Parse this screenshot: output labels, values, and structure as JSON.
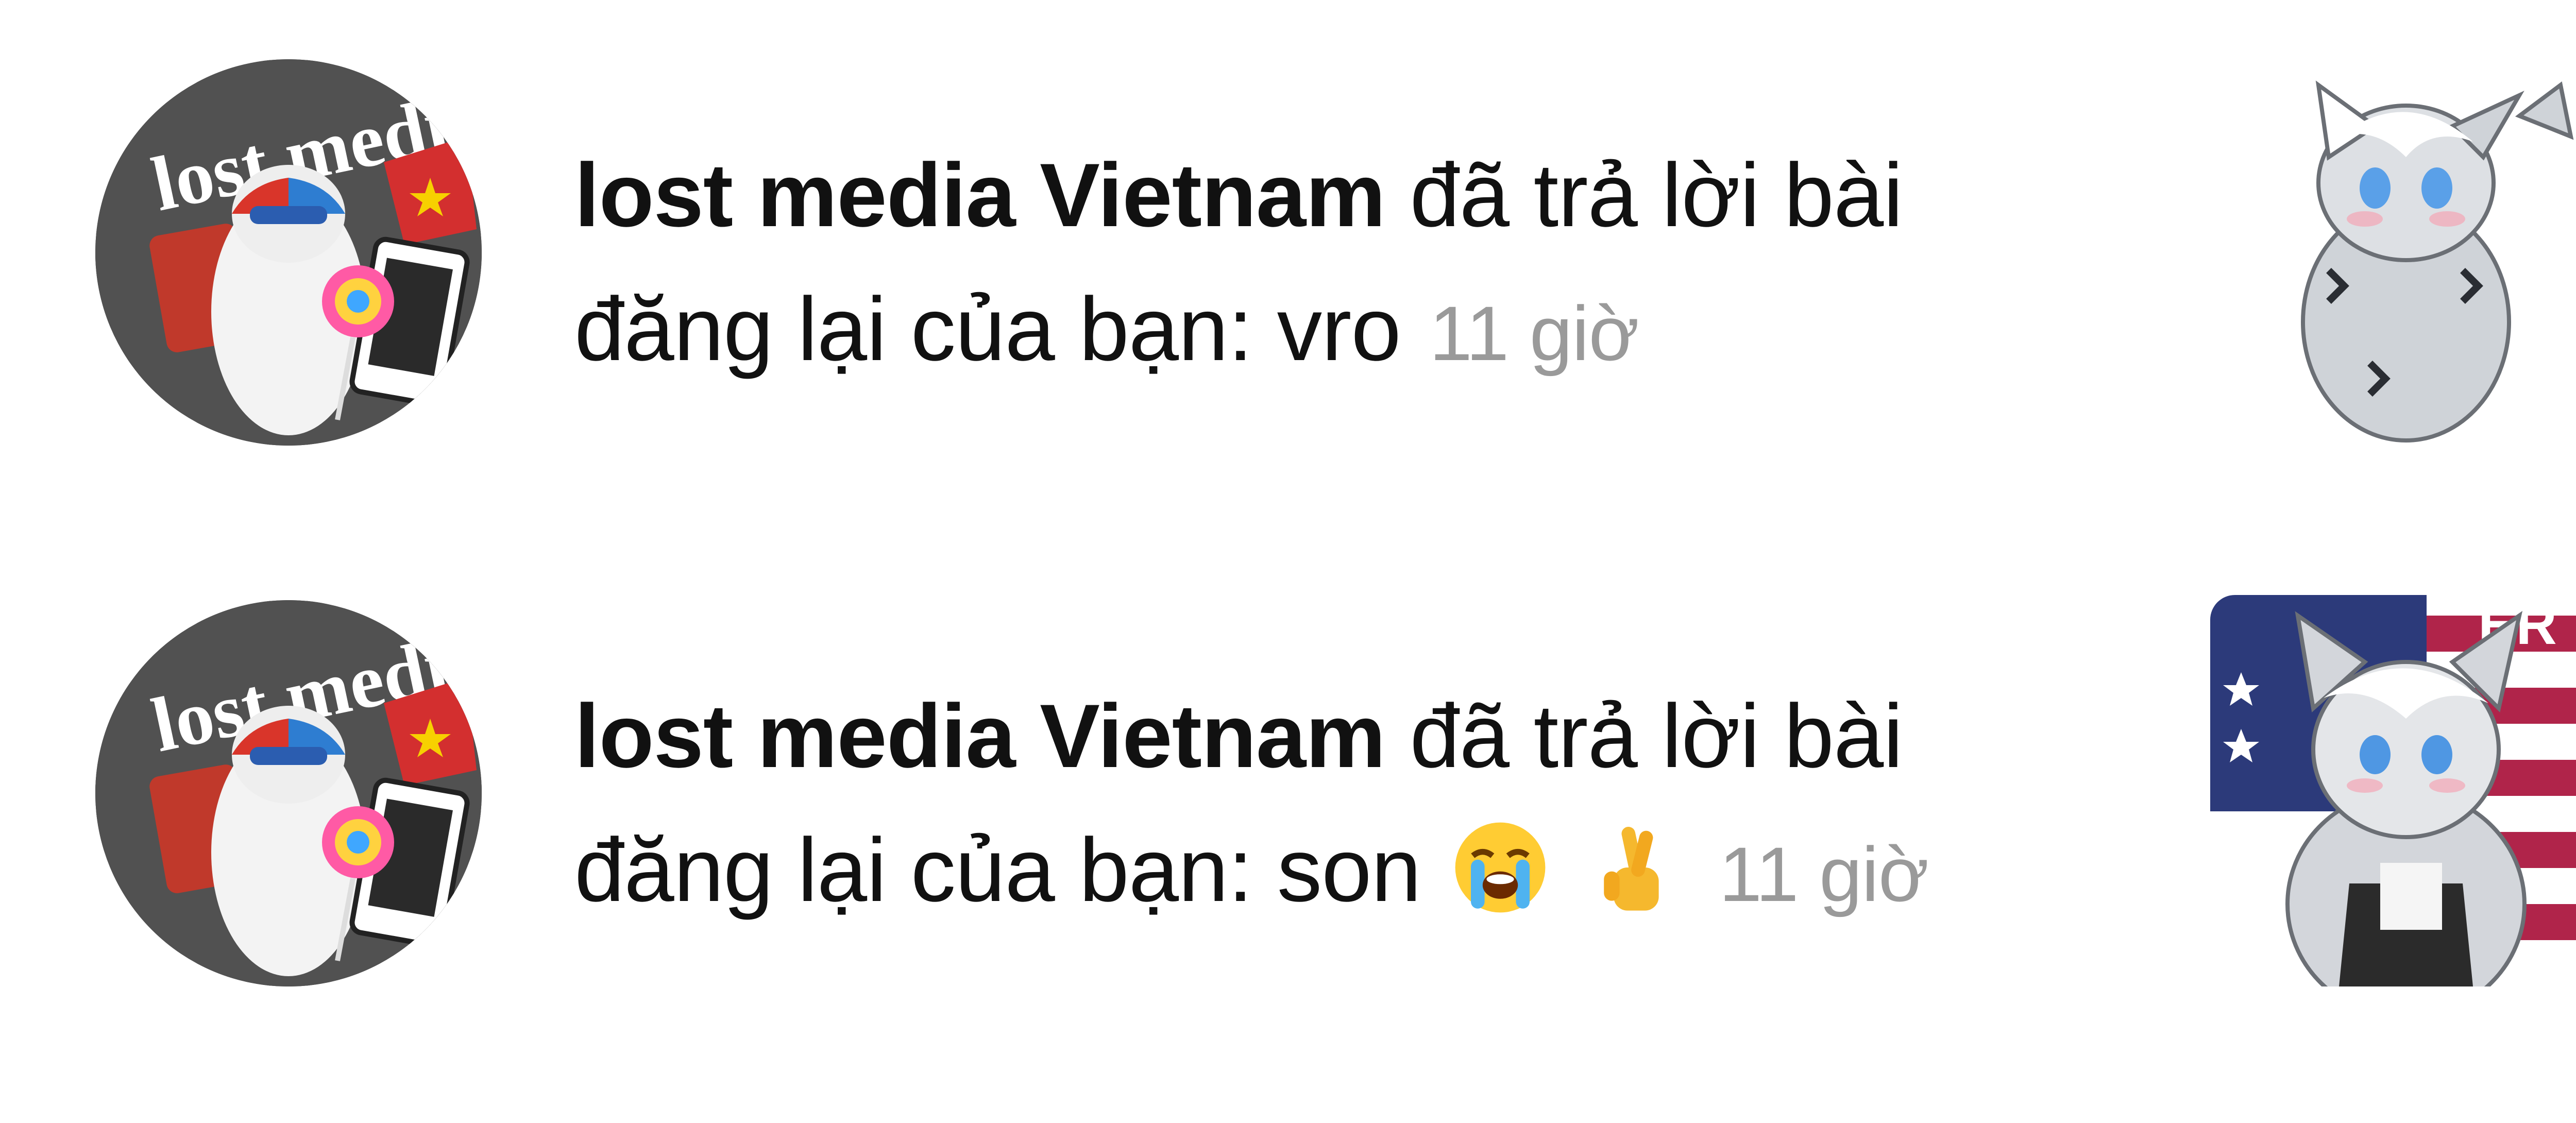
{
  "notifications": [
    {
      "user": "lost media Vietnam",
      "action": "đã trả lời bài đăng lại của bạn:",
      "reply": "vro",
      "time": "11 giờ",
      "avatar_text": "lost media",
      "avatar_icon": "lost-media-vietnam-avatar",
      "thumbnail_icon": "grey-cat-character-thumbnail"
    },
    {
      "user": "lost media Vietnam",
      "action": "đã trả lời bài đăng lại của bạn:",
      "reply": "son",
      "reply_emojis": [
        "loudly-crying-face",
        "crossed-fingers"
      ],
      "time": "11 giờ",
      "avatar_text": "lost media",
      "avatar_icon": "lost-media-vietnam-avatar",
      "thumbnail_icon": "grey-cat-character-with-flag-thumbnail",
      "thumbnail_text": "ER"
    }
  ],
  "colors": {
    "name": "#111111",
    "time": "#9a9a9a",
    "flag_red": "#b0244a",
    "flag_blue": "#2c3a7a"
  }
}
